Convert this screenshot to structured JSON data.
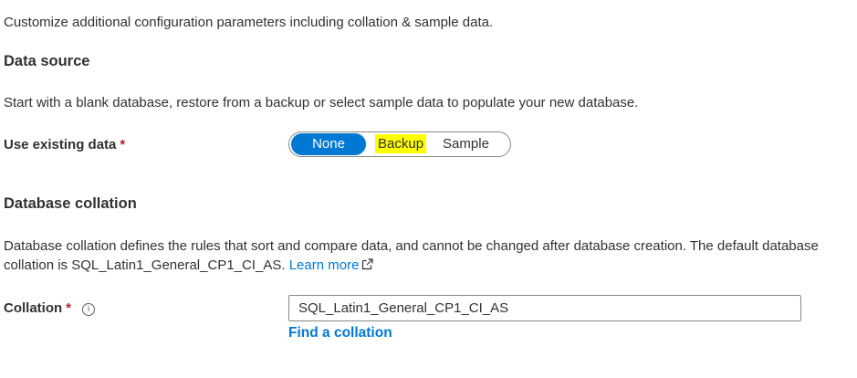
{
  "intro": "Customize additional configuration parameters including collation & sample data.",
  "data_source": {
    "heading": "Data source",
    "description": "Start with a blank database, restore from a backup or select sample data to populate your new database.",
    "existing_label": "Use existing data",
    "required_mark": "*",
    "options": [
      "None",
      "Backup",
      "Sample"
    ],
    "selected": "None"
  },
  "collation": {
    "heading": "Database collation",
    "description_text": "Database collation defines the rules that sort and compare data, and cannot be changed after database creation. The default database collation is SQL_Latin1_General_CP1_CI_AS.",
    "learn_more": "Learn more",
    "label": "Collation",
    "required_mark": "*",
    "info_glyph": "i",
    "value": "SQL_Latin1_General_CP1_CI_AS",
    "find_link": "Find a collation"
  },
  "colors": {
    "accent": "#0078d4",
    "required": "#a4262c",
    "highlight": "#ffff00",
    "text": "#323130"
  },
  "icons": {
    "external_link": "external-link-icon",
    "info": "info-icon"
  }
}
